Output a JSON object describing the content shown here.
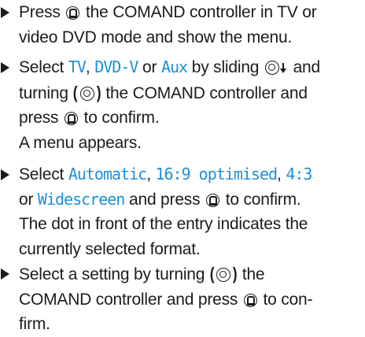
{
  "steps": [
    {
      "line1_a": "Press",
      "line1_b": "the COMAND controller in TV or",
      "line2": "video DVD mode and show the menu."
    },
    {
      "line1_a": "Select",
      "term_tv": "TV",
      "sep1": ",",
      "term_dvd": "DVD-V",
      "or": "or",
      "term_aux": "Aux",
      "line1_b": "by sliding",
      "line1_c": "and",
      "line2_a": "turning",
      "line2_b": "the COMAND controller and",
      "line3_a": "press",
      "line3_b": "to confirm.",
      "result": "A menu appears."
    },
    {
      "line1_a": "Select",
      "term_auto": "Automatic",
      "sep1": ",",
      "term_169": "16:9 optimised",
      "sep2": ",",
      "term_43": "4:3",
      "line2_or": "or",
      "term_wide": "Widescreen",
      "line2_b": "and press",
      "line2_c": "to confirm.",
      "line3": "The dot in front of the entry indicates the",
      "line4": "currently selected format."
    },
    {
      "line1_a": "Select a setting by turning",
      "line1_b": "the",
      "line2_a": "COMAND controller and press",
      "line2_b": "to con-",
      "line3": "firm."
    }
  ],
  "icons": {
    "press": "press-controller-icon",
    "slide": "slide-down-icon",
    "turn": "turn-controller-icon"
  },
  "colors": {
    "text": "#1b1b1b",
    "term": "#1f8fd6"
  }
}
